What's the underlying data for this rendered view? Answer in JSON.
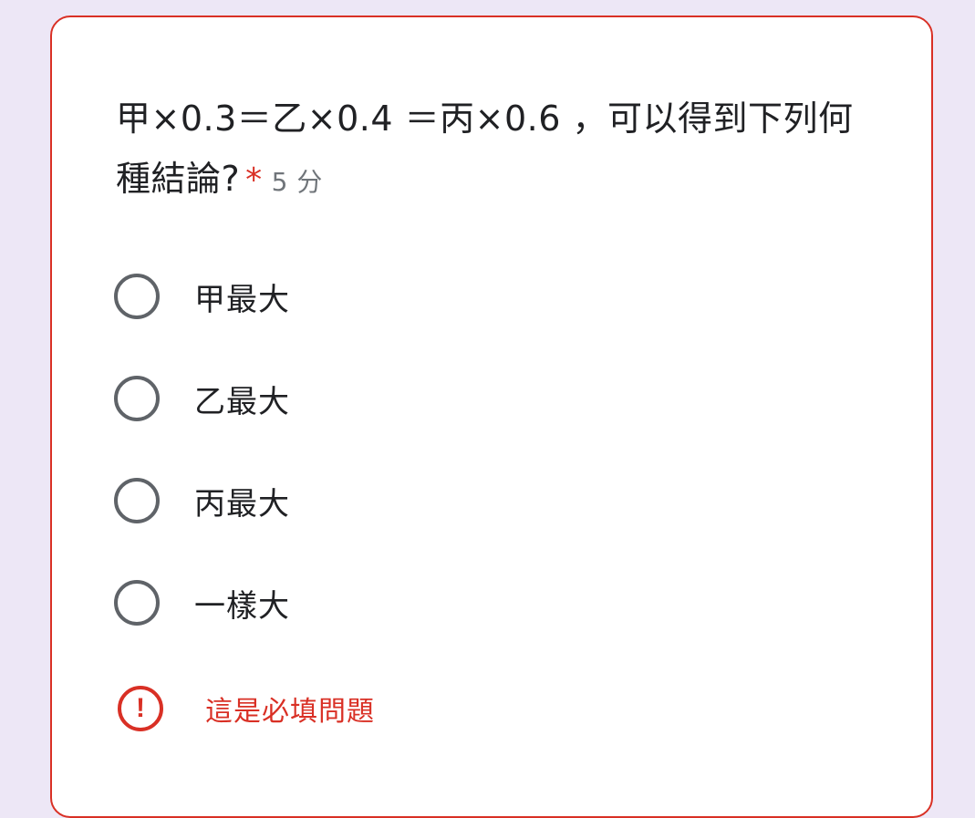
{
  "question": {
    "text": "甲×0.3＝乙×0.4 ＝丙×0.6 ，可以得到下列何種結論?",
    "required_marker": "*",
    "points": "5 分"
  },
  "options": [
    {
      "label": "甲最大",
      "selected": false
    },
    {
      "label": "乙最大",
      "selected": false
    },
    {
      "label": "丙最大",
      "selected": false
    },
    {
      "label": "一樣大",
      "selected": false
    }
  ],
  "error": {
    "icon": "exclamation-circle-icon",
    "text": "這是必填問題"
  },
  "colors": {
    "background": "#ede7f6",
    "card_border_error": "#d93025",
    "required": "#d93025",
    "radio_border": "#5f6368",
    "text": "#202124",
    "points": "#70757a"
  }
}
